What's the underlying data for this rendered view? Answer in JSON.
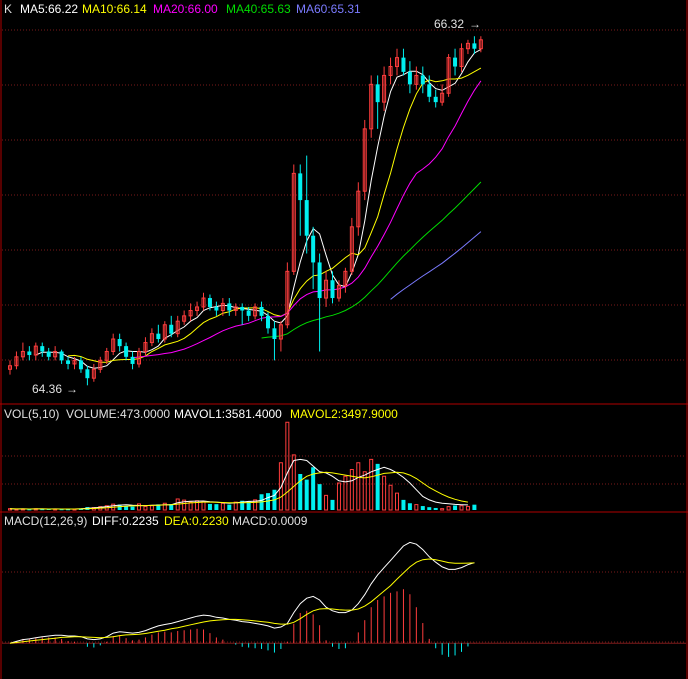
{
  "colors": {
    "background": "#000000",
    "frame": "#b00000",
    "grid": "#7a1a1a",
    "up": "#ff3d3d",
    "down": "#00f0f0",
    "text": "#e0e0e0",
    "ma5": "#ffffff",
    "ma10": "#ffff00",
    "ma20": "#ff00ff",
    "ma40": "#00dd00",
    "ma60": "#7b7bff"
  },
  "price_panel": {
    "label": "K",
    "legend": [
      {
        "text": "MA5:66.22",
        "color": "#ffffff"
      },
      {
        "text": "MA10:66.14",
        "color": "#ffff00"
      },
      {
        "text": "MA20:66.00",
        "color": "#ff00ff"
      },
      {
        "text": "MA40:65.63",
        "color": "#00dd00"
      },
      {
        "text": "MA60:65.31",
        "color": "#7b7bff"
      }
    ],
    "high_marker": {
      "text": "66.32",
      "arrow": "→"
    },
    "low_marker": {
      "text": "64.36",
      "arrow": "→"
    }
  },
  "volume_panel": {
    "legend": [
      {
        "text": "VOL(5,10)",
        "color": "#e0e0e0"
      },
      {
        "text": "VOLUME:473.0000",
        "color": "#e0e0e0"
      },
      {
        "text": "MAVOL1:3581.4000",
        "color": "#ffffff"
      },
      {
        "text": "MAVOL2:3497.9000",
        "color": "#ffff00"
      }
    ]
  },
  "macd_panel": {
    "legend": [
      {
        "text": "MACD(12,26,9)",
        "color": "#e0e0e0"
      },
      {
        "text": "DIFF:0.2235",
        "color": "#ffffff"
      },
      {
        "text": "DEA:0.2230",
        "color": "#ffff00"
      },
      {
        "text": "MACD:0.0009",
        "color": "#e0e0e0"
      }
    ]
  },
  "chart_data": {
    "type": "candlestick",
    "price_range": [
      64.3,
      66.4
    ],
    "candles": [
      [
        64.45,
        64.47,
        64.42,
        64.5
      ],
      [
        64.47,
        64.52,
        64.45,
        64.55
      ],
      [
        64.52,
        64.55,
        64.5,
        64.6
      ],
      [
        64.55,
        64.53,
        64.5,
        64.58
      ],
      [
        64.53,
        64.58,
        64.5,
        64.6
      ],
      [
        64.58,
        64.55,
        64.52,
        64.6
      ],
      [
        64.55,
        64.52,
        64.5,
        64.57
      ],
      [
        64.52,
        64.55,
        64.5,
        64.58
      ],
      [
        64.55,
        64.5,
        64.48,
        64.56
      ],
      [
        64.5,
        64.48,
        64.45,
        64.52
      ],
      [
        64.48,
        64.5,
        64.45,
        64.52
      ],
      [
        64.5,
        64.45,
        64.43,
        64.52
      ],
      [
        64.45,
        64.4,
        64.36,
        64.47
      ],
      [
        64.4,
        64.45,
        64.38,
        64.48
      ],
      [
        64.45,
        64.5,
        64.43,
        64.52
      ],
      [
        64.5,
        64.55,
        64.48,
        64.57
      ],
      [
        64.55,
        64.62,
        64.53,
        64.65
      ],
      [
        64.62,
        64.58,
        64.55,
        64.65
      ],
      [
        64.58,
        64.52,
        64.5,
        64.6
      ],
      [
        64.52,
        64.48,
        64.45,
        64.55
      ],
      [
        64.48,
        64.55,
        64.46,
        64.57
      ],
      [
        64.55,
        64.6,
        64.53,
        64.63
      ],
      [
        64.6,
        64.65,
        64.58,
        64.68
      ],
      [
        64.65,
        64.62,
        64.6,
        64.7
      ],
      [
        64.62,
        64.7,
        64.6,
        64.72
      ],
      [
        64.7,
        64.65,
        64.63,
        64.75
      ],
      [
        64.65,
        64.72,
        64.63,
        64.75
      ],
      [
        64.72,
        64.75,
        64.7,
        64.78
      ],
      [
        64.75,
        64.78,
        64.72,
        64.82
      ],
      [
        64.78,
        64.8,
        64.75,
        64.83
      ],
      [
        64.8,
        64.85,
        64.78,
        64.88
      ],
      [
        64.85,
        64.8,
        64.78,
        64.87
      ],
      [
        64.8,
        64.78,
        64.75,
        64.83
      ],
      [
        64.78,
        64.82,
        64.75,
        64.85
      ],
      [
        64.82,
        64.78,
        64.75,
        64.85
      ],
      [
        64.78,
        64.8,
        64.75,
        64.82
      ],
      [
        64.8,
        64.78,
        64.7,
        64.82
      ],
      [
        64.78,
        64.75,
        64.72,
        64.8
      ],
      [
        64.75,
        64.8,
        64.73,
        64.82
      ],
      [
        64.8,
        64.75,
        64.72,
        64.83
      ],
      [
        64.75,
        64.68,
        64.65,
        64.77
      ],
      [
        64.68,
        64.62,
        64.5,
        64.72
      ],
      [
        64.62,
        64.7,
        64.55,
        64.72
      ],
      [
        64.7,
        65.0,
        64.68,
        65.05
      ],
      [
        65.0,
        65.55,
        64.98,
        65.6
      ],
      [
        65.55,
        65.4,
        65.2,
        65.6
      ],
      [
        65.4,
        65.2,
        65.1,
        65.65
      ],
      [
        65.2,
        65.05,
        64.9,
        65.25
      ],
      [
        65.05,
        64.85,
        64.55,
        65.1
      ],
      [
        64.85,
        64.95,
        64.8,
        65.0
      ],
      [
        64.95,
        64.85,
        64.82,
        65.0
      ],
      [
        64.85,
        64.92,
        64.83,
        64.95
      ],
      [
        64.92,
        65.0,
        64.88,
        65.02
      ],
      [
        65.0,
        65.25,
        64.98,
        65.3
      ],
      [
        65.25,
        65.45,
        65.2,
        65.5
      ],
      [
        65.45,
        65.8,
        65.4,
        65.85
      ],
      [
        65.8,
        66.05,
        65.75,
        66.1
      ],
      [
        66.05,
        65.95,
        65.8,
        66.1
      ],
      [
        65.95,
        66.1,
        65.9,
        66.15
      ],
      [
        66.1,
        66.15,
        66.05,
        66.2
      ],
      [
        66.15,
        66.2,
        66.1,
        66.25
      ],
      [
        66.2,
        66.12,
        66.1,
        66.25
      ],
      [
        66.12,
        66.05,
        66.0,
        66.18
      ],
      [
        66.05,
        66.1,
        66.02,
        66.15
      ],
      [
        66.1,
        66.05,
        66.0,
        66.15
      ],
      [
        66.05,
        65.98,
        65.95,
        66.1
      ],
      [
        65.98,
        65.95,
        65.92,
        66.02
      ],
      [
        65.95,
        66.0,
        65.93,
        66.05
      ],
      [
        66.0,
        66.2,
        65.98,
        66.22
      ],
      [
        66.2,
        66.15,
        66.1,
        66.25
      ],
      [
        66.15,
        66.25,
        66.12,
        66.28
      ],
      [
        66.25,
        66.28,
        66.22,
        66.3
      ],
      [
        66.28,
        66.25,
        66.22,
        66.32
      ],
      [
        66.25,
        66.3,
        66.23,
        66.32
      ]
    ],
    "volume_range": [
      0,
      8000
    ],
    "volume": [
      120,
      80,
      95,
      60,
      110,
      75,
      90,
      85,
      70,
      65,
      80,
      140,
      260,
      220,
      300,
      380,
      520,
      480,
      360,
      300,
      540,
      320,
      380,
      500,
      600,
      520,
      980,
      880,
      700,
      820,
      760,
      540,
      520,
      600,
      480,
      700,
      820,
      760,
      900,
      1400,
      1500,
      1800,
      4200,
      7800,
      4900,
      3200,
      2700,
      3800,
      2300,
      1300,
      900,
      2400,
      3000,
      3600,
      4200,
      3400,
      4500,
      4100,
      3000,
      2200,
      1500,
      900,
      600,
      480,
      350,
      250,
      180,
      120,
      300,
      400,
      380,
      320,
      473
    ],
    "mavol1": [
      110,
      90,
      95,
      90,
      100,
      95,
      90,
      95,
      85,
      80,
      90,
      110,
      150,
      190,
      240,
      300,
      380,
      440,
      470,
      430,
      400,
      390,
      420,
      440,
      460,
      470,
      650,
      740,
      780,
      790,
      800,
      740,
      700,
      650,
      600,
      640,
      700,
      760,
      780,
      850,
      1100,
      1300,
      2000,
      3300,
      4400,
      4500,
      4400,
      3900,
      3400,
      3300,
      3000,
      2600,
      2500,
      2600,
      2900,
      3100,
      3400,
      3600,
      3800,
      3600,
      3300,
      2900,
      2400,
      1800,
      1200,
      900,
      700,
      600,
      550,
      500,
      470,
      450,
      3581.4
    ],
    "mavol2": [
      110,
      95,
      95,
      92,
      95,
      94,
      93,
      93,
      90,
      88,
      88,
      95,
      110,
      135,
      165,
      200,
      250,
      300,
      340,
      360,
      380,
      390,
      410,
      430,
      450,
      460,
      520,
      580,
      630,
      670,
      700,
      700,
      690,
      670,
      650,
      640,
      650,
      660,
      680,
      720,
      800,
      900,
      1150,
      1600,
      2100,
      2600,
      3000,
      3200,
      3300,
      3350,
      3300,
      3200,
      3100,
      3000,
      2900,
      2850,
      2950,
      3100,
      3250,
      3300,
      3350,
      3300,
      3100,
      2800,
      2400,
      2000,
      1700,
      1400,
      1150,
      950,
      800,
      700,
      3497.9
    ],
    "macd_range": [
      -0.08,
      0.32
    ],
    "diff": [
      0.0,
      0.005,
      0.01,
      0.012,
      0.015,
      0.018,
      0.02,
      0.022,
      0.022,
      0.02,
      0.02,
      0.018,
      0.012,
      0.01,
      0.012,
      0.018,
      0.028,
      0.032,
      0.03,
      0.028,
      0.03,
      0.035,
      0.042,
      0.048,
      0.052,
      0.055,
      0.06,
      0.065,
      0.07,
      0.075,
      0.078,
      0.076,
      0.072,
      0.07,
      0.066,
      0.064,
      0.06,
      0.058,
      0.055,
      0.052,
      0.048,
      0.042,
      0.045,
      0.055,
      0.085,
      0.11,
      0.125,
      0.13,
      0.12,
      0.1,
      0.09,
      0.085,
      0.085,
      0.092,
      0.11,
      0.135,
      0.165,
      0.19,
      0.21,
      0.23,
      0.25,
      0.27,
      0.28,
      0.275,
      0.26,
      0.24,
      0.225,
      0.212,
      0.205,
      0.205,
      0.21,
      0.218,
      0.2235
    ],
    "dea": [
      0.0,
      0.002,
      0.004,
      0.006,
      0.008,
      0.01,
      0.012,
      0.014,
      0.016,
      0.017,
      0.018,
      0.018,
      0.017,
      0.016,
      0.015,
      0.016,
      0.018,
      0.021,
      0.023,
      0.024,
      0.025,
      0.027,
      0.03,
      0.033,
      0.036,
      0.04,
      0.043,
      0.047,
      0.051,
      0.055,
      0.059,
      0.062,
      0.064,
      0.065,
      0.066,
      0.066,
      0.065,
      0.064,
      0.062,
      0.06,
      0.058,
      0.055,
      0.053,
      0.053,
      0.058,
      0.068,
      0.08,
      0.09,
      0.095,
      0.096,
      0.095,
      0.093,
      0.092,
      0.092,
      0.095,
      0.103,
      0.115,
      0.13,
      0.145,
      0.16,
      0.178,
      0.195,
      0.212,
      0.225,
      0.232,
      0.234,
      0.232,
      0.228,
      0.224,
      0.222,
      0.222,
      0.2225,
      0.223
    ]
  }
}
